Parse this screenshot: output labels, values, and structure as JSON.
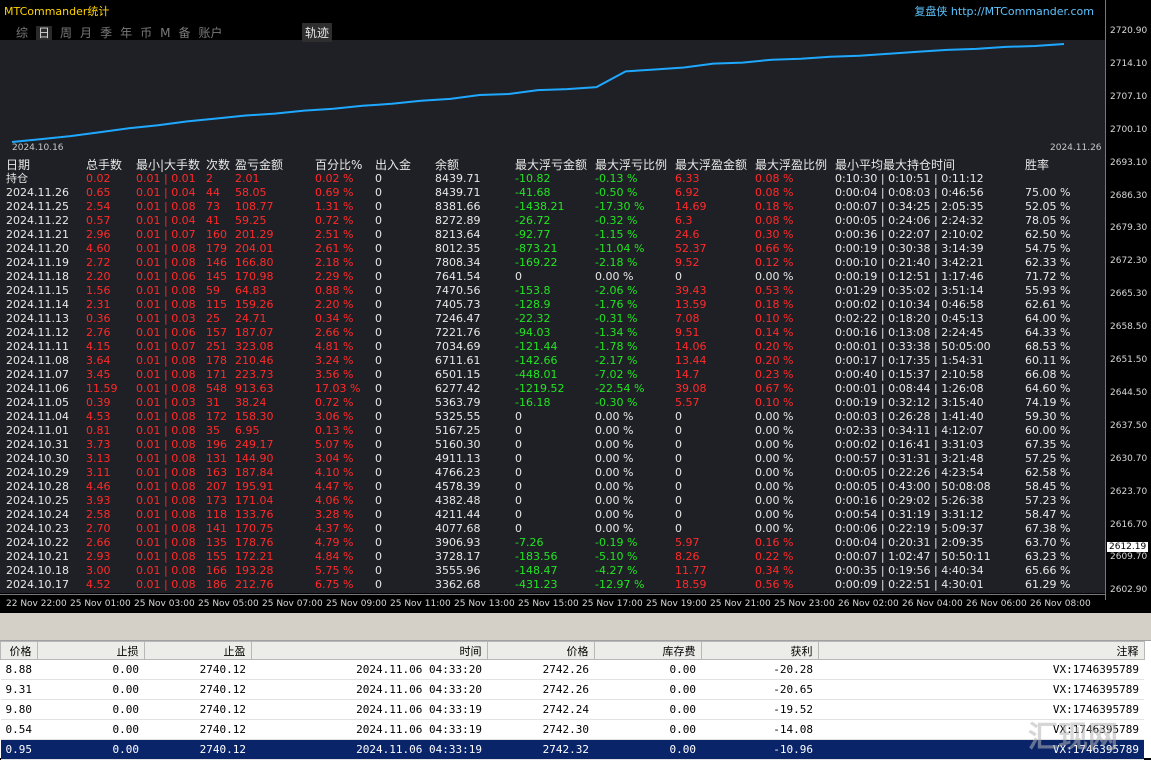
{
  "header": {
    "title": "MTCommander统计",
    "brand": "复盘侠 http://MTCommander.com",
    "tabs": [
      "综",
      "日",
      "周",
      "月",
      "季",
      "年",
      "币",
      "M",
      "备",
      "账户"
    ],
    "active_tab": "日",
    "track_button": "轨迹"
  },
  "equity": {
    "start_date": "2024.10.16",
    "end_date": "2024.11.26",
    "points": [
      0,
      0.03,
      0.06,
      0.1,
      0.14,
      0.17,
      0.21,
      0.24,
      0.27,
      0.29,
      0.32,
      0.34,
      0.37,
      0.39,
      0.42,
      0.44,
      0.48,
      0.49,
      0.53,
      0.54,
      0.56,
      0.72,
      0.74,
      0.76,
      0.8,
      0.81,
      0.84,
      0.85,
      0.87,
      0.88,
      0.9,
      0.92,
      0.94,
      0.95,
      0.97,
      0.98,
      1.0
    ]
  },
  "y_axis": [
    "2720.90",
    "2714.10",
    "2707.10",
    "2700.10",
    "2693.10",
    "2686.30",
    "2679.30",
    "2672.30",
    "2665.30",
    "2658.50",
    "2651.50",
    "2644.50",
    "2637.50",
    "2630.70",
    "2623.70",
    "2616.70",
    "2609.70",
    "2602.90"
  ],
  "current_price": "2612.19",
  "x_axis": [
    "22 Nov 22:00",
    "25 Nov 01:00",
    "25 Nov 03:00",
    "25 Nov 05:00",
    "25 Nov 07:00",
    "25 Nov 09:00",
    "25 Nov 11:00",
    "25 Nov 13:00",
    "25 Nov 15:00",
    "25 Nov 17:00",
    "25 Nov 19:00",
    "25 Nov 21:00",
    "25 Nov 23:00",
    "26 Nov 02:00",
    "26 Nov 04:00",
    "26 Nov 06:00",
    "26 Nov 08:00"
  ],
  "stats": {
    "headers": [
      "日期",
      "总手数",
      "最小|大手数",
      "次数",
      "盈亏金额",
      "百分比%",
      "出入金",
      "余额",
      "最大浮亏金额",
      "最大浮亏比例",
      "最大浮盈金额",
      "最大浮盈比例",
      "最小平均最大持仓时间",
      "胜率"
    ],
    "rows": [
      [
        "持仓",
        "0.02",
        "0.01 | 0.01",
        "2",
        "2.01",
        "0.02 %",
        "0",
        "8439.71",
        "-10.82",
        "-0.13 %",
        "6.33",
        "0.08 %",
        "0:10:30 | 0:10:51 | 0:11:12",
        ""
      ],
      [
        "2024.11.26",
        "0.65",
        "0.01 | 0.04",
        "44",
        "58.05",
        "0.69 %",
        "0",
        "8439.71",
        "-41.68",
        "-0.50 %",
        "6.92",
        "0.08 %",
        "0:00:04 | 0:08:03 | 0:46:56",
        "75.00 %"
      ],
      [
        "2024.11.25",
        "2.54",
        "0.01 | 0.08",
        "73",
        "108.77",
        "1.31 %",
        "0",
        "8381.66",
        "-1438.21",
        "-17.30 %",
        "14.69",
        "0.18 %",
        "0:00:07 | 0:34:25 | 2:05:35",
        "52.05 %"
      ],
      [
        "2024.11.22",
        "0.57",
        "0.01 | 0.04",
        "41",
        "59.25",
        "0.72 %",
        "0",
        "8272.89",
        "-26.72",
        "-0.32 %",
        "6.3",
        "0.08 %",
        "0:00:05 | 0:24:06 | 2:24:32",
        "78.05 %"
      ],
      [
        "2024.11.21",
        "2.96",
        "0.01 | 0.07",
        "160",
        "201.29",
        "2.51 %",
        "0",
        "8213.64",
        "-92.77",
        "-1.15 %",
        "24.6",
        "0.30 %",
        "0:00:36 | 0:22:07 | 2:10:02",
        "62.50 %"
      ],
      [
        "2024.11.20",
        "4.60",
        "0.01 | 0.08",
        "179",
        "204.01",
        "2.61 %",
        "0",
        "8012.35",
        "-873.21",
        "-11.04 %",
        "52.37",
        "0.66 %",
        "0:00:19 | 0:30:38 | 3:14:39",
        "54.75 %"
      ],
      [
        "2024.11.19",
        "2.72",
        "0.01 | 0.08",
        "146",
        "166.80",
        "2.18 %",
        "0",
        "7808.34",
        "-169.22",
        "-2.18 %",
        "9.52",
        "0.12 %",
        "0:00:10 | 0:21:40 | 3:42:21",
        "62.33 %"
      ],
      [
        "2024.11.18",
        "2.20",
        "0.01 | 0.06",
        "145",
        "170.98",
        "2.29 %",
        "0",
        "7641.54",
        "0",
        "0.00 %",
        "0",
        "0.00 %",
        "0:00:19 | 0:12:51 | 1:17:46",
        "71.72 %"
      ],
      [
        "2024.11.15",
        "1.56",
        "0.01 | 0.08",
        "59",
        "64.83",
        "0.88 %",
        "0",
        "7470.56",
        "-153.8",
        "-2.06 %",
        "39.43",
        "0.53 %",
        "0:01:29 | 0:35:02 | 3:51:14",
        "55.93 %"
      ],
      [
        "2024.11.14",
        "2.31",
        "0.01 | 0.08",
        "115",
        "159.26",
        "2.20 %",
        "0",
        "7405.73",
        "-128.9",
        "-1.76 %",
        "13.59",
        "0.18 %",
        "0:00:02 | 0:10:34 | 0:46:58",
        "62.61 %"
      ],
      [
        "2024.11.13",
        "0.36",
        "0.01 | 0.03",
        "25",
        "24.71",
        "0.34 %",
        "0",
        "7246.47",
        "-22.32",
        "-0.31 %",
        "7.08",
        "0.10 %",
        "0:02:22 | 0:18:20 | 0:45:13",
        "64.00 %"
      ],
      [
        "2024.11.12",
        "2.76",
        "0.01 | 0.06",
        "157",
        "187.07",
        "2.66 %",
        "0",
        "7221.76",
        "-94.03",
        "-1.34 %",
        "9.51",
        "0.14 %",
        "0:00:16 | 0:13:08 | 2:24:45",
        "64.33 %"
      ],
      [
        "2024.11.11",
        "4.15",
        "0.01 | 0.07",
        "251",
        "323.08",
        "4.81 %",
        "0",
        "7034.69",
        "-121.44",
        "-1.78 %",
        "14.06",
        "0.20 %",
        "0:00:01 | 0:33:38 | 50:05:00",
        "68.53 %"
      ],
      [
        "2024.11.08",
        "3.64",
        "0.01 | 0.08",
        "178",
        "210.46",
        "3.24 %",
        "0",
        "6711.61",
        "-142.66",
        "-2.17 %",
        "13.44",
        "0.20 %",
        "0:00:17 | 0:17:35 | 1:54:31",
        "60.11 %"
      ],
      [
        "2024.11.07",
        "3.45",
        "0.01 | 0.08",
        "171",
        "223.73",
        "3.56 %",
        "0",
        "6501.15",
        "-448.01",
        "-7.02 %",
        "14.7",
        "0.23 %",
        "0:00:40 | 0:15:37 | 2:10:58",
        "66.08 %"
      ],
      [
        "2024.11.06",
        "11.59",
        "0.01 | 0.08",
        "548",
        "913.63",
        "17.03 %",
        "0",
        "6277.42",
        "-1219.52",
        "-22.54 %",
        "39.08",
        "0.67 %",
        "0:00:01 | 0:08:44 | 1:26:08",
        "64.60 %"
      ],
      [
        "2024.11.05",
        "0.39",
        "0.01 | 0.03",
        "31",
        "38.24",
        "0.72 %",
        "0",
        "5363.79",
        "-16.18",
        "-0.30 %",
        "5.57",
        "0.10 %",
        "0:00:19 | 0:32:12 | 3:15:40",
        "74.19 %"
      ],
      [
        "2024.11.04",
        "4.53",
        "0.01 | 0.08",
        "172",
        "158.30",
        "3.06 %",
        "0",
        "5325.55",
        "0",
        "0.00 %",
        "0",
        "0.00 %",
        "0:00:03 | 0:26:28 | 1:41:40",
        "59.30 %"
      ],
      [
        "2024.11.01",
        "0.81",
        "0.01 | 0.08",
        "35",
        "6.95",
        "0.13 %",
        "0",
        "5167.25",
        "0",
        "0.00 %",
        "0",
        "0.00 %",
        "0:02:33 | 0:34:11 | 4:12:07",
        "60.00 %"
      ],
      [
        "2024.10.31",
        "3.73",
        "0.01 | 0.08",
        "196",
        "249.17",
        "5.07 %",
        "0",
        "5160.30",
        "0",
        "0.00 %",
        "0",
        "0.00 %",
        "0:00:02 | 0:16:41 | 3:31:03",
        "67.35 %"
      ],
      [
        "2024.10.30",
        "3.13",
        "0.01 | 0.08",
        "131",
        "144.90",
        "3.04 %",
        "0",
        "4911.13",
        "0",
        "0.00 %",
        "0",
        "0.00 %",
        "0:00:57 | 0:31:31 | 3:21:48",
        "57.25 %"
      ],
      [
        "2024.10.29",
        "3.11",
        "0.01 | 0.08",
        "163",
        "187.84",
        "4.10 %",
        "0",
        "4766.23",
        "0",
        "0.00 %",
        "0",
        "0.00 %",
        "0:00:05 | 0:22:26 | 4:23:54",
        "62.58 %"
      ],
      [
        "2024.10.28",
        "4.46",
        "0.01 | 0.08",
        "207",
        "195.91",
        "4.47 %",
        "0",
        "4578.39",
        "0",
        "0.00 %",
        "0",
        "0.00 %",
        "0:00:05 | 0:43:00 | 50:08:08",
        "58.45 %"
      ],
      [
        "2024.10.25",
        "3.93",
        "0.01 | 0.08",
        "173",
        "171.04",
        "4.06 %",
        "0",
        "4382.48",
        "0",
        "0.00 %",
        "0",
        "0.00 %",
        "0:00:16 | 0:29:02 | 5:26:38",
        "57.23 %"
      ],
      [
        "2024.10.24",
        "2.58",
        "0.01 | 0.08",
        "118",
        "133.76",
        "3.28 %",
        "0",
        "4211.44",
        "0",
        "0.00 %",
        "0",
        "0.00 %",
        "0:00:54 | 0:31:19 | 3:31:12",
        "58.47 %"
      ],
      [
        "2024.10.23",
        "2.70",
        "0.01 | 0.08",
        "141",
        "170.75",
        "4.37 %",
        "0",
        "4077.68",
        "0",
        "0.00 %",
        "0",
        "0.00 %",
        "0:00:06 | 0:22:19 | 5:09:37",
        "67.38 %"
      ],
      [
        "2024.10.22",
        "2.66",
        "0.01 | 0.08",
        "135",
        "178.76",
        "4.79 %",
        "0",
        "3906.93",
        "-7.26",
        "-0.19 %",
        "5.97",
        "0.16 %",
        "0:00:04 | 0:20:31 | 2:09:35",
        "63.70 %"
      ],
      [
        "2024.10.21",
        "2.93",
        "0.01 | 0.08",
        "155",
        "172.21",
        "4.84 %",
        "0",
        "3728.17",
        "-183.56",
        "-5.10 %",
        "8.26",
        "0.22 %",
        "0:00:07 | 1:02:47 | 50:50:11",
        "63.23 %"
      ],
      [
        "2024.10.18",
        "3.00",
        "0.01 | 0.08",
        "166",
        "193.28",
        "5.75 %",
        "0",
        "3555.96",
        "-148.47",
        "-4.27 %",
        "11.77",
        "0.34 %",
        "0:00:35 | 0:19:56 | 4:40:34",
        "65.66 %"
      ],
      [
        "2024.10.17",
        "4.52",
        "0.01 | 0.08",
        "186",
        "212.76",
        "6.75 %",
        "0",
        "3362.68",
        "-431.23",
        "-12.97 %",
        "18.59",
        "0.56 %",
        "0:00:09 | 0:22:51 | 4:30:01",
        "61.29 %"
      ]
    ]
  },
  "orders": {
    "headers": [
      "价格",
      "止损",
      "止盈",
      "时间",
      "价格",
      "库存费",
      "获利",
      "注释"
    ],
    "rows": [
      [
        "8.88",
        "0.00",
        "2740.12",
        "2024.11.06 04:33:20",
        "2742.26",
        "0.00",
        "-20.28",
        "VX:1746395789"
      ],
      [
        "9.31",
        "0.00",
        "2740.12",
        "2024.11.06 04:33:20",
        "2742.26",
        "0.00",
        "-20.65",
        "VX:1746395789"
      ],
      [
        "9.80",
        "0.00",
        "2740.12",
        "2024.11.06 04:33:19",
        "2742.24",
        "0.00",
        "-19.52",
        "VX:1746395789"
      ],
      [
        "0.54",
        "0.00",
        "2740.12",
        "2024.11.06 04:33:19",
        "2742.30",
        "0.00",
        "-14.08",
        "VX:1746395789"
      ],
      [
        "0.95",
        "0.00",
        "2740.12",
        "2024.11.06 04:33:19",
        "2742.32",
        "0.00",
        "-10.96",
        "VX:1746395789"
      ]
    ],
    "selected_row": 4
  },
  "watermark": "汇现网",
  "colors": {
    "positive": "#ff2a2a",
    "negative": "#22e422",
    "line": "#1fa8ff",
    "selected": "#0a246a"
  }
}
